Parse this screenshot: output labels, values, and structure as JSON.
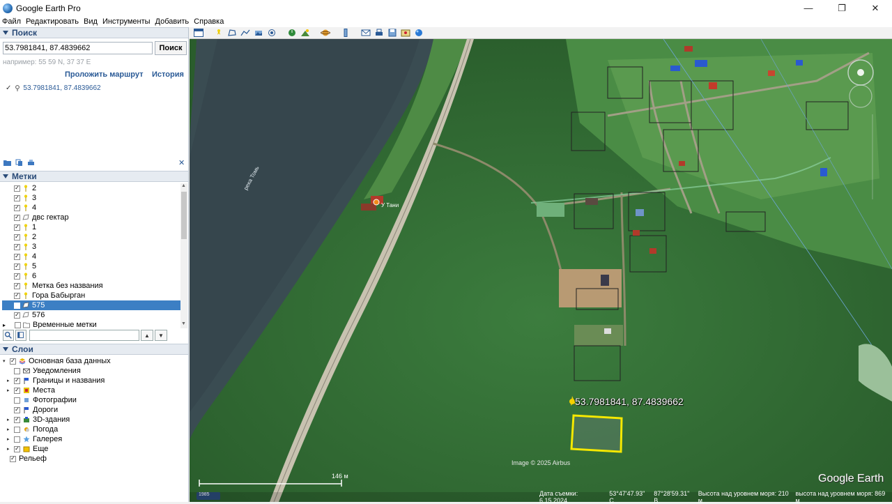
{
  "window": {
    "title": "Google Earth Pro"
  },
  "menu": [
    "Файл",
    "Редактировать",
    "Вид",
    "Инструменты",
    "Добавить",
    "Справка"
  ],
  "search": {
    "header": "Поиск",
    "value": "53.7981841, 87.4839662",
    "button": "Поиск",
    "hint": "например: 55 59 N, 37 37 E",
    "route_link": "Проложить маршрут",
    "history_link": "История",
    "result": "53.7981841, 87.4839662"
  },
  "places": {
    "header": "Метки",
    "items": [
      {
        "label": "2",
        "icon": "pushpin-icon",
        "checked": true
      },
      {
        "label": "3",
        "icon": "pushpin-icon",
        "checked": true
      },
      {
        "label": "4",
        "icon": "pushpin-icon",
        "checked": true
      },
      {
        "label": "двс гектар",
        "icon": "polygon-icon",
        "checked": true
      },
      {
        "label": "1",
        "icon": "pushpin-icon",
        "checked": true
      },
      {
        "label": "2",
        "icon": "pushpin-icon",
        "checked": true
      },
      {
        "label": "3",
        "icon": "pushpin-icon",
        "checked": true
      },
      {
        "label": "4",
        "icon": "pushpin-icon",
        "checked": true
      },
      {
        "label": "5",
        "icon": "pushpin-icon",
        "checked": true
      },
      {
        "label": "6",
        "icon": "pushpin-icon",
        "checked": true
      },
      {
        "label": "Метка без названия",
        "icon": "pushpin-icon",
        "checked": true
      },
      {
        "label": "Гора Бабырган",
        "icon": "pushpin-icon",
        "checked": true
      },
      {
        "label": "575",
        "icon": "polygon-icon",
        "checked": false,
        "selected": true
      },
      {
        "label": "576",
        "icon": "polygon-icon",
        "checked": true
      },
      {
        "label": "Временные метки",
        "icon": "folder-icon",
        "checked": false,
        "folder": true
      }
    ]
  },
  "layers": {
    "header": "Слои",
    "items": [
      {
        "label": "Основная база данных",
        "icon": "database-icon",
        "checked": true,
        "expander": true,
        "level": 0
      },
      {
        "label": "Уведомления",
        "icon": "mail-icon",
        "checked": false,
        "expander": false,
        "level": 1
      },
      {
        "label": "Границы и названия",
        "icon": "flag-icon",
        "checked": true,
        "expander": true,
        "level": 1
      },
      {
        "label": "Места",
        "icon": "places-icon",
        "checked": true,
        "expander": true,
        "level": 1
      },
      {
        "label": "Фотографии",
        "icon": "photo-icon",
        "checked": false,
        "expander": false,
        "level": 1
      },
      {
        "label": "Дороги",
        "icon": "road-icon",
        "checked": true,
        "expander": false,
        "level": 1
      },
      {
        "label": "3D-здания",
        "icon": "building-icon",
        "checked": true,
        "expander": true,
        "level": 1
      },
      {
        "label": "Погода",
        "icon": "weather-icon",
        "checked": false,
        "expander": true,
        "level": 1
      },
      {
        "label": "Галерея",
        "icon": "gallery-icon",
        "checked": false,
        "expander": true,
        "level": 1
      },
      {
        "label": "Еще",
        "icon": "more-icon",
        "checked": true,
        "expander": true,
        "level": 1
      },
      {
        "label": "Рельеф",
        "icon": "",
        "checked": true,
        "expander": false,
        "level": 0
      }
    ]
  },
  "map": {
    "placemark_label": "53.7981841, 87.4839662",
    "copyright": "Image © 2025 Airbus",
    "logo": "Google Earth",
    "scale": "146 м",
    "river_label": "река Томь",
    "cafe_label": "У Тани",
    "year_badge": "1985"
  },
  "status": {
    "date": "Дата съемки: 6.15.2024",
    "lat": "53°47'47.93\" С",
    "lon": "87°28'59.31\" В",
    "elevation": "Высота над уровнем моря:   210 м",
    "eye": "высота над уровнем моря:   869 м"
  }
}
